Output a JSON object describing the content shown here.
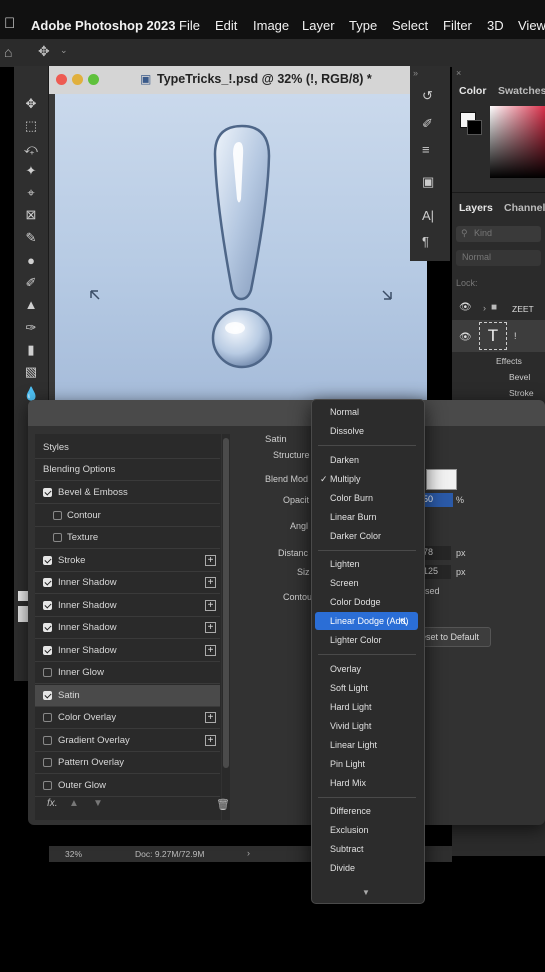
{
  "menubar": {
    "app": "Adobe Photoshop 2023",
    "items": [
      "File",
      "Edit",
      "Image",
      "Layer",
      "Type",
      "Select",
      "Filter",
      "3D",
      "View"
    ]
  },
  "document": {
    "title": "TypeTricks_!.psd @ 32% (!, RGB/8) *",
    "zoom": "32%",
    "doc_info": "Doc: 9.27M/72.9M"
  },
  "right_panel": {
    "tabs": [
      "Color",
      "Swatches"
    ],
    "layers_tabs": [
      "Layers",
      "Channels"
    ],
    "kind_placeholder": "Kind",
    "blend_placeholder": "Normal",
    "lock_label": "Lock:",
    "layers": [
      {
        "name": "ZEET"
      },
      {
        "name": "!"
      }
    ],
    "effects_label": "Effects",
    "effects": [
      "Bevel",
      "Stroke"
    ]
  },
  "dialog": {
    "styles_header": "Styles",
    "blending_options": "Blending Options",
    "items": [
      {
        "label": "Bevel & Emboss",
        "checked": true,
        "plus": false,
        "indent": false,
        "selected": false
      },
      {
        "label": "Contour",
        "checked": false,
        "plus": false,
        "indent": true,
        "selected": false
      },
      {
        "label": "Texture",
        "checked": false,
        "plus": false,
        "indent": true,
        "selected": false
      },
      {
        "label": "Stroke",
        "checked": true,
        "plus": true,
        "indent": false,
        "selected": false
      },
      {
        "label": "Inner Shadow",
        "checked": true,
        "plus": true,
        "indent": false,
        "selected": false
      },
      {
        "label": "Inner Shadow",
        "checked": true,
        "plus": true,
        "indent": false,
        "selected": false
      },
      {
        "label": "Inner Shadow",
        "checked": true,
        "plus": true,
        "indent": false,
        "selected": false
      },
      {
        "label": "Inner Shadow",
        "checked": true,
        "plus": true,
        "indent": false,
        "selected": false
      },
      {
        "label": "Inner Glow",
        "checked": false,
        "plus": false,
        "indent": false,
        "selected": false
      },
      {
        "label": "Satin",
        "checked": true,
        "plus": false,
        "indent": false,
        "selected": true
      },
      {
        "label": "Color Overlay",
        "checked": false,
        "plus": true,
        "indent": false,
        "selected": false
      },
      {
        "label": "Gradient Overlay",
        "checked": false,
        "plus": true,
        "indent": false,
        "selected": false
      },
      {
        "label": "Pattern Overlay",
        "checked": false,
        "plus": false,
        "indent": false,
        "selected": false
      },
      {
        "label": "Outer Glow",
        "checked": false,
        "plus": false,
        "indent": false,
        "selected": false
      }
    ],
    "fx_label": "fx.",
    "section_title": "Satin",
    "structure_label": "Structure",
    "blend_mode_label": "Blend Mod",
    "opacity_label": "Opacit",
    "opacity_value": "50",
    "opacity_unit": "%",
    "angle_label": "Angl",
    "distance_label": "Distanc",
    "distance_value": "78",
    "distance_unit": "px",
    "size_label": "Siz",
    "size_value": "125",
    "size_unit": "px",
    "contour_label": "Contou",
    "invert_label": "sed",
    "reset_button": "eset to Default"
  },
  "blend_menu": {
    "groups": [
      [
        "Normal",
        "Dissolve"
      ],
      [
        "Darken",
        "Multiply",
        "Color Burn",
        "Linear Burn",
        "Darker Color"
      ],
      [
        "Lighten",
        "Screen",
        "Color Dodge",
        "Linear Dodge (Add)",
        "Lighter Color"
      ],
      [
        "Overlay",
        "Soft Light",
        "Hard Light",
        "Vivid Light",
        "Linear Light",
        "Pin Light",
        "Hard Mix"
      ],
      [
        "Difference",
        "Exclusion",
        "Subtract",
        "Divide"
      ]
    ],
    "checked": "Multiply",
    "highlighted": "Linear Dodge (Add)"
  }
}
